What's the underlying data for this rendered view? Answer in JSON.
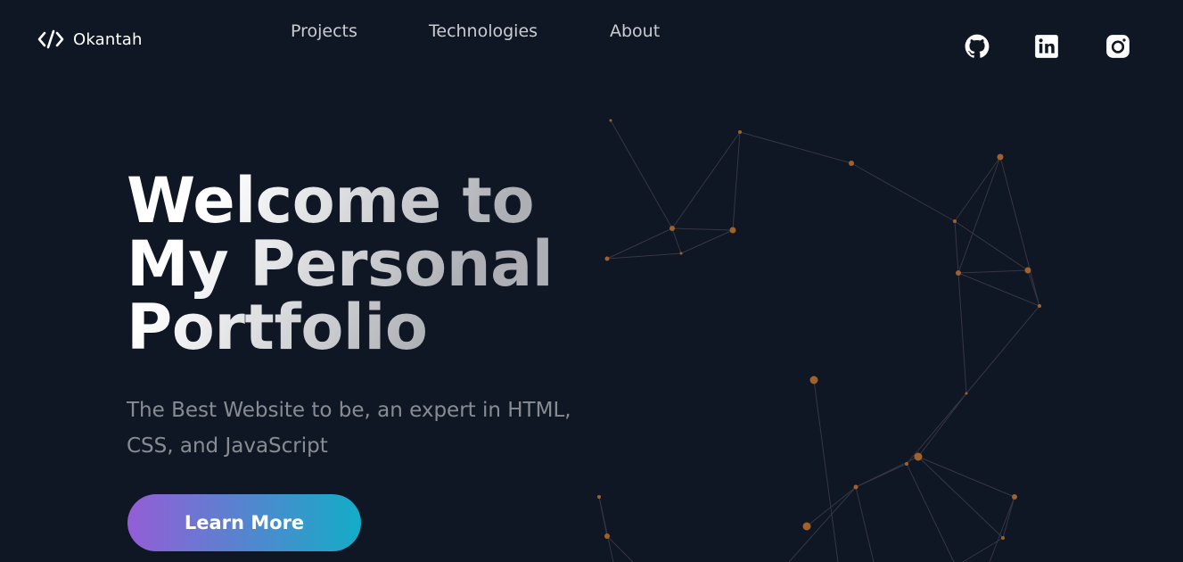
{
  "header": {
    "logo_text": "Okantah",
    "nav": [
      {
        "label": "Projects"
      },
      {
        "label": "Technologies"
      },
      {
        "label": "About"
      }
    ],
    "socials": [
      {
        "icon": "github-icon"
      },
      {
        "icon": "linkedin-icon"
      },
      {
        "icon": "instagram-icon"
      }
    ]
  },
  "hero": {
    "title_line_1": "Welcome to",
    "title_line_2": "My Personal",
    "title_line_3": "Portfolio",
    "subtitle": "The Best Website to be, an expert in HTML, CSS, and JavaScript",
    "cta_label": "Learn More"
  },
  "colors": {
    "background": "#0f1624",
    "text_primary": "#ffffff",
    "text_muted": "rgba(255,255,255,0.5)",
    "button_gradient_start": "#945dd6",
    "button_gradient_end": "#13adc7",
    "particle": "#a0612b",
    "particle_line": "#3a3440"
  }
}
